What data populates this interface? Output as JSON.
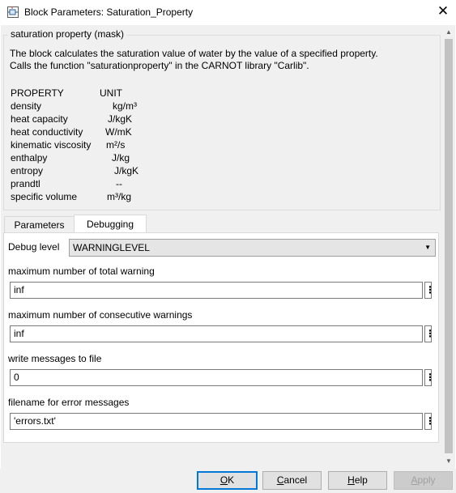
{
  "window": {
    "title": "Block Parameters: Saturation_Property",
    "app_icon": "simulink-block-icon",
    "close_icon": "close-icon"
  },
  "mask": {
    "group_title": "saturation property (mask)",
    "description": [
      "The block calculates the saturation value of water by the value of a specified property.",
      "Calls the function \"saturationproperty\" in the CARNOT library \"Carlib\"."
    ],
    "table_header": {
      "property": "PROPERTY",
      "unit": "UNIT"
    },
    "properties": [
      {
        "name": "density",
        "unit": "kg/m³"
      },
      {
        "name": "heat capacity",
        "unit": "J/kgK"
      },
      {
        "name": "heat conductivity",
        "unit": "W/mK"
      },
      {
        "name": "kinematic viscosity",
        "unit": "m²/s"
      },
      {
        "name": "enthalpy",
        "unit": "J/kg"
      },
      {
        "name": "entropy",
        "unit": "J/kgK"
      },
      {
        "name": "prandtl",
        "unit": "--"
      },
      {
        "name": "specific volume",
        "unit": "m³/kg"
      }
    ]
  },
  "tabs": [
    {
      "label": "Parameters",
      "active": false
    },
    {
      "label": "Debugging",
      "active": true
    }
  ],
  "debugging": {
    "debug_level": {
      "label": "Debug level",
      "value": "WARNINGLEVEL",
      "arrow_icon": "chevron-down-icon"
    },
    "fields": [
      {
        "label": "maximum number of total warning",
        "value": "inf"
      },
      {
        "label": "maximum number of consecutive warnings",
        "value": "inf"
      },
      {
        "label": "write messages to file",
        "value": "0"
      },
      {
        "label": "filename for error messages",
        "value": "'errors.txt'"
      }
    ]
  },
  "buttons": {
    "ok": {
      "label": "OK",
      "mnemonic": "O"
    },
    "cancel": {
      "label": "Cancel",
      "mnemonic": "C"
    },
    "help": {
      "label": "Help",
      "mnemonic": "H"
    },
    "apply": {
      "label": "Apply",
      "mnemonic": "A",
      "enabled": false
    }
  },
  "colors": {
    "default_button_border": "#0078d7",
    "dialog_background": "#f0f0f0",
    "disabled_text": "#a0a0a0"
  }
}
